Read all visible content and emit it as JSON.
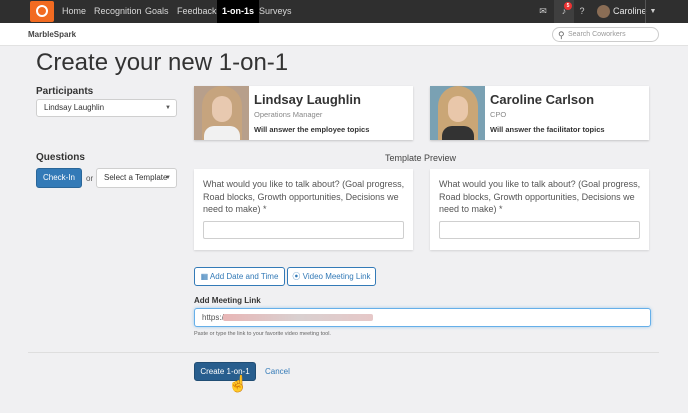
{
  "topnav": {
    "items": [
      "Home",
      "Recognition",
      "Goals",
      "Feedback",
      "1-on-1s",
      "Surveys"
    ],
    "active": "1-on-1s",
    "notification_count": "5",
    "user_name": "Caroline"
  },
  "subheader": {
    "brand": "MarbleSpark",
    "search_placeholder": "Search Coworkers"
  },
  "page": {
    "title": "Create your new 1-on-1"
  },
  "participants": {
    "label": "Participants",
    "selected": "Lindsay Laughlin"
  },
  "questions": {
    "label": "Questions",
    "checkin_label": "Check-In",
    "or_text": "or",
    "template_select": "Select a Template"
  },
  "people": [
    {
      "name": "Lindsay Laughlin",
      "role": "Operations Manager",
      "note": "Will answer the employee topics"
    },
    {
      "name": "Caroline Carlson",
      "role": "CPO",
      "note": "Will answer the facilitator topics"
    }
  ],
  "preview": {
    "title": "Template Preview",
    "question": "What would you like to talk about? (Goal progress, Road blocks, Growth opportunities, Decisions we need to make) *"
  },
  "actions": {
    "add_date_label": "Add Date and Time",
    "video_link_label": "Video Meeting Link",
    "meeting_link_label": "Add Meeting Link",
    "meeting_link_value": "https://",
    "meeting_help": "Paste or type the link to your favorite video meeting tool.",
    "create_label": "Create 1-on-1",
    "cancel_label": "Cancel"
  },
  "colors": {
    "primary": "#337ab7",
    "brand_orange": "#f26b21",
    "nav_bg": "#2f2f2f"
  }
}
